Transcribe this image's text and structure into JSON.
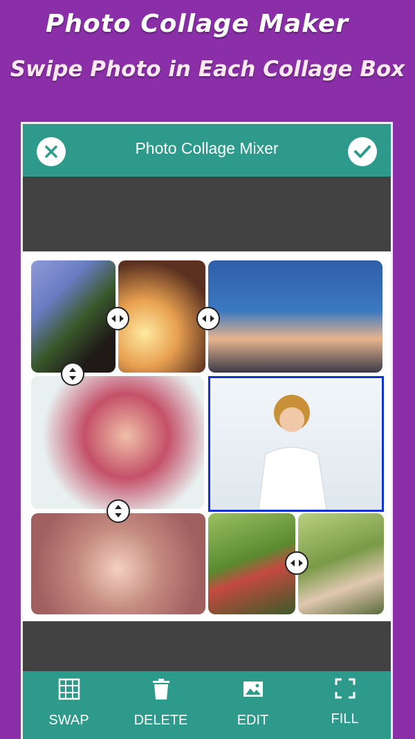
{
  "promo": {
    "title": "Photo Collage Maker",
    "subtitle": "Swipe Photo in Each Collage Box"
  },
  "appbar": {
    "title": "Photo Collage Mixer",
    "close_icon": "close-icon",
    "confirm_icon": "check-icon"
  },
  "toolbar": {
    "items": [
      {
        "label": "SWAP",
        "icon": "swap-grid-icon"
      },
      {
        "label": "DELETE",
        "icon": "trash-icon"
      },
      {
        "label": "EDIT",
        "icon": "image-icon"
      },
      {
        "label": "FILL",
        "icon": "fullscreen-icon"
      }
    ]
  },
  "colors": {
    "background": "#8a2fa8",
    "appbar": "#2e9a8c",
    "ad_area": "#424242",
    "selection": "#1133cc"
  }
}
